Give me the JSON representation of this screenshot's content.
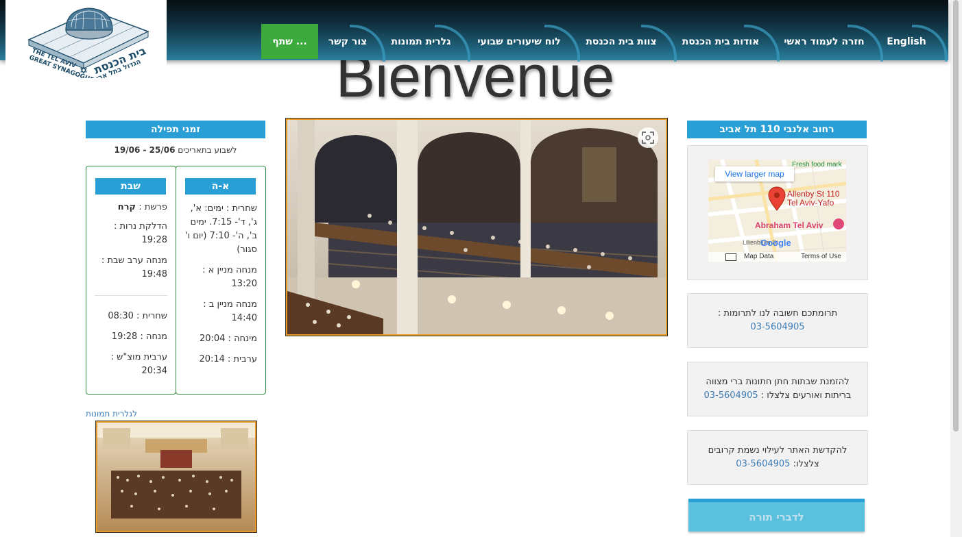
{
  "nav": {
    "items": [
      {
        "label": "English"
      },
      {
        "label": "חזרה לעמוד ראשי"
      },
      {
        "label": "אודות בית הכנסת"
      },
      {
        "label": "צוות בית הכנסת"
      },
      {
        "label": "לוח שיעורים שבועי"
      },
      {
        "label": "גלרית תמונות"
      },
      {
        "label": "צור קשר"
      }
    ],
    "share_label": "שתף ..."
  },
  "logo": {
    "hebrew_line1": "בית הכנסת",
    "hebrew_line2": "הגדול בתל אביב",
    "english_line1": "THE TEL AVIV",
    "english_line2": "GREAT SYNAGOGUE"
  },
  "page_heading": "Bienvenue",
  "prayer_times": {
    "title": "זמני תפילה",
    "week_label": "לשבוע בתאריכים",
    "week_range": "19/06 - 25/06",
    "weekday": {
      "title": "א-ה",
      "items": [
        "שחרית : ימים: א', ג', ד'- 7:15. ימים ב', ה'- 7:10 (יום ו' סגור)",
        "מנחה מניין א : 13:20",
        "מנחה מניין ב : 14:40",
        "מינחה : 20:04",
        "ערבית : 20:14"
      ]
    },
    "shabbat": {
      "title": "שבת",
      "parasha_label": "פרשת :",
      "parasha_value": "קרח",
      "items": [
        "הדלקת נרות : 19:28",
        "מנחה ערב שבת : 19:48"
      ],
      "items_after": [
        "שחרית : 08:30",
        "מנחה : 19:28",
        "ערבית מוצ\"ש : 20:34"
      ]
    }
  },
  "gallery": {
    "link_label": "לגלרית תמונות"
  },
  "address": {
    "title": "רחוב אלנבי 110 תל אביב"
  },
  "map": {
    "larger_map_label": "View larger map",
    "pin_label_line1": "Allenby St 110",
    "pin_label_line2": "Tel Aviv-Yafo",
    "place_label": "Abraham Tel Aviv",
    "top_label": "Fresh food mark",
    "google_label": "Google",
    "map_data_label": "Map Data",
    "terms_label": "Terms of Use",
    "street_label": "Lilienblum St"
  },
  "donations": {
    "text": "תרומתכם חשובה לנו לתרומות :",
    "phone": "03-5604905"
  },
  "events": {
    "text": "להזמנת שבתות חתן חתונות ברי מצווה בריתות ואורעים צלצלו :",
    "phone": "03-5604905"
  },
  "dedication": {
    "text": "להקדשת האתר לעילוי נשמת קרובים צלצלו:",
    "phone": "03-5604905"
  },
  "torah_button": {
    "label": "לדברי תורה"
  },
  "colors": {
    "accent_blue": "#2a9fd6",
    "box_green": "#2e8b3d",
    "photo_border": "#e89c28",
    "link_blue": "#3d7bb5",
    "share_green": "#3daa3d"
  }
}
